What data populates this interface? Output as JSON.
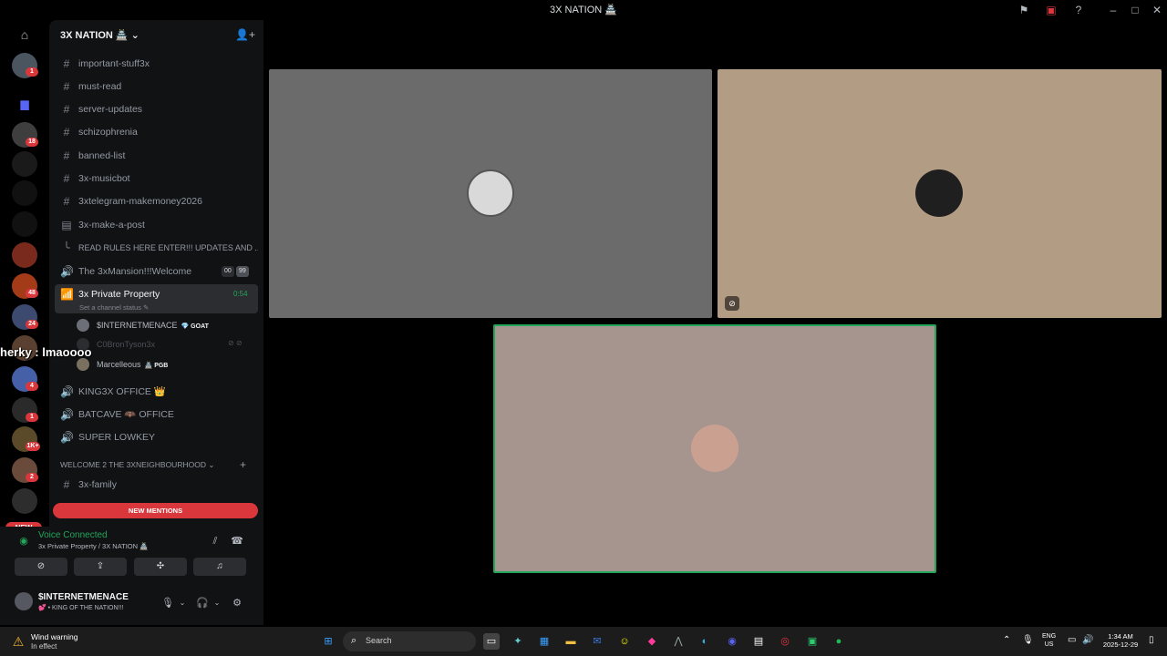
{
  "window": {
    "title": "3X NATION 🏯"
  },
  "servers": {
    "badges": [
      "1",
      "18",
      "48",
      "24",
      "4",
      "1",
      "1K+",
      "2"
    ],
    "new_label": "NEW"
  },
  "guild": {
    "name": "3X NATION 🏯 ⌄"
  },
  "channels": [
    {
      "name": "important-stuff3x",
      "icon": "#"
    },
    {
      "name": "must-read",
      "icon": "#"
    },
    {
      "name": "server-updates",
      "icon": "#"
    },
    {
      "name": "schizophrenia",
      "icon": "#"
    },
    {
      "name": "banned-list",
      "icon": "#"
    },
    {
      "name": "3x-musicbot",
      "icon": "#"
    },
    {
      "name": "3xtelegram-makemoney2026",
      "icon": "#"
    },
    {
      "name": "3x-make-a-post",
      "icon": "▤"
    },
    {
      "name": "READ RULES HERE ENTER!!! UPDATES AND ...",
      "icon": "╰"
    },
    {
      "name": "The 3xMansion!!!Welcome",
      "icon": "🔊"
    },
    {
      "name": "3x Private Property",
      "icon": "📶"
    },
    {
      "name": "KING3X OFFICE 👑",
      "icon": "🔊"
    },
    {
      "name": "BATCAVE 🦇 OFFICE",
      "icon": "🔊"
    },
    {
      "name": "SUPER LOWKEY",
      "icon": "🔊"
    },
    {
      "name": "3x-family",
      "icon": "#"
    }
  ],
  "mansion_counts": [
    "00",
    "99"
  ],
  "private_timer": "0:54",
  "channel_status": "Set a channel status ✎",
  "voice_users": [
    {
      "name": "$INTERNETMENACE",
      "tag": "💎 GOAT"
    },
    {
      "name": "C0BronTyson3x",
      "tag": ""
    },
    {
      "name": "Marcelleous",
      "tag": "🏯 PGB"
    }
  ],
  "overlay_text": "herky : lmaoooo",
  "category": {
    "name": "WELCOME 2 THE 3XNEIGHBOURHOOD ⌄",
    "plus": "+"
  },
  "new_mentions": "NEW MENTIONS",
  "voice_panel": {
    "title": "Voice Connected",
    "subtitle": "3x Private Property / 3X NATION 🏯"
  },
  "user_panel": {
    "name": "$INTERNETMENACE",
    "status": "💕 • KING OF THE NATION!!!"
  },
  "taskbar": {
    "weather_title": "Wind warning",
    "weather_sub": "In effect",
    "search_placeholder": "Search",
    "lang_line1": "ENG",
    "lang_line2": "US",
    "time": "1:34 AM",
    "date": "2025-12-29"
  },
  "colors": {
    "tile1": "#6b6b6b",
    "tile2": "#b39c84",
    "tile3": "#a6958e",
    "speaking_border": "#23a55a",
    "accent_red": "#da373c"
  }
}
